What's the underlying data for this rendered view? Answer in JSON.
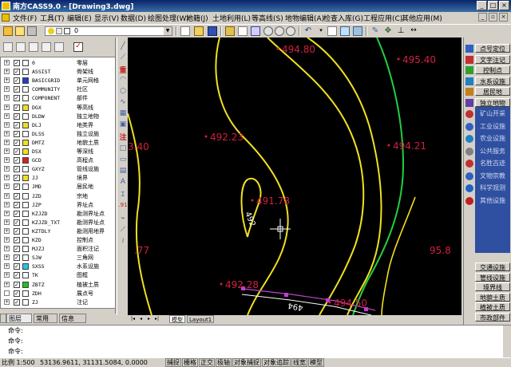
{
  "window": {
    "title": "南方CASS9.0 - [Drawing3.dwg]",
    "minimize": "_",
    "maximize": "□",
    "close": "×"
  },
  "menu": {
    "items": [
      "文件(F)",
      "工具(T)",
      "编辑(E)",
      "显示(V)",
      "数据(D)",
      "绘图处理(W)",
      "地籍(J)",
      "土地利用(L)",
      "等高线(S)",
      "地物编辑(A)",
      "检查入库(G)",
      "工程应用(C)",
      "其他应用(M)"
    ],
    "mdi": {
      "minimize": "_",
      "restore": "▫",
      "close": "×"
    }
  },
  "toolbar": {
    "layer_value": "0"
  },
  "layers": [
    {
      "name": "0",
      "desc": "零层",
      "color": "#ffffff",
      "expand": "+"
    },
    {
      "name": "ASSIST",
      "desc": "骨架线",
      "color": "#ffffff",
      "expand": "+"
    },
    {
      "name": "BASICGRID",
      "desc": "单元网格",
      "color": "#1f3fd0",
      "expand": "+"
    },
    {
      "name": "COMMUNITY",
      "desc": "社区",
      "color": "#ffffff",
      "expand": "+"
    },
    {
      "name": "COMPONENT",
      "desc": "部件",
      "color": "#ffffff",
      "expand": "+"
    },
    {
      "name": "DGX",
      "desc": "等高线",
      "color": "#f0e020",
      "expand": "+"
    },
    {
      "name": "DLDW",
      "desc": "独立地物",
      "color": "#ffffff",
      "expand": "+"
    },
    {
      "name": "DLJ",
      "desc": "地类界",
      "color": "#f0e020",
      "expand": "+"
    },
    {
      "name": "DLSS",
      "desc": "独立设施",
      "color": "#ffffff",
      "expand": "+"
    },
    {
      "name": "DMTZ",
      "desc": "地貌土质",
      "color": "#f0e020",
      "expand": "+"
    },
    {
      "name": "DSX",
      "desc": "等深线",
      "color": "#f0e020",
      "expand": "+"
    },
    {
      "name": "GCD",
      "desc": "高程点",
      "color": "#d82020",
      "expand": "+"
    },
    {
      "name": "GXYZ",
      "desc": "管线设施",
      "color": "#ffffff",
      "expand": "+"
    },
    {
      "name": "JJ",
      "desc": "境界",
      "color": "#f0e020",
      "expand": "+"
    },
    {
      "name": "JMD",
      "desc": "居民地",
      "color": "#ffffff",
      "expand": "+"
    },
    {
      "name": "JZD",
      "desc": "宗地",
      "color": "#ffffff",
      "expand": "+"
    },
    {
      "name": "JZP",
      "desc": "界址点",
      "color": "#ffffff",
      "expand": "+"
    },
    {
      "name": "KZJZD",
      "desc": "勘测界址点",
      "color": "#ffffff",
      "expand": "+"
    },
    {
      "name": "KZJZD_TXT",
      "desc": "勘测界址点",
      "color": "#ffffff",
      "expand": "+"
    },
    {
      "name": "KZTDLY",
      "desc": "勘测用地界",
      "color": "#ffffff",
      "expand": "+"
    },
    {
      "name": "KZD",
      "desc": "控制点",
      "color": "#ffffff",
      "expand": "+"
    },
    {
      "name": "MJZJ",
      "desc": "面积注记",
      "color": "#ffffff",
      "expand": "+"
    },
    {
      "name": "SJW",
      "desc": "三角网",
      "color": "#ffffff",
      "expand": "+"
    },
    {
      "name": "SXSS",
      "desc": "水系设施",
      "color": "#20c8e0",
      "expand": "+"
    },
    {
      "name": "TK",
      "desc": "图框",
      "color": "#ffffff",
      "expand": "+"
    },
    {
      "name": "ZBTZ",
      "desc": "植被土质",
      "color": "#20c020",
      "expand": "+"
    },
    {
      "name": "ZDH",
      "desc": "展点号",
      "color": "#ffffff",
      "expand": ""
    },
    {
      "name": "ZJ",
      "desc": "注记",
      "color": "#ffffff",
      "expand": "+"
    }
  ],
  "layer_checkmark": "✓",
  "panel_tabs": [
    "图层",
    "常用",
    "信息"
  ],
  "canvas": {
    "elevations": [
      "494.80",
      "495.40",
      "492.23",
      "494.21",
      "491.78",
      "492.28",
      "494.50"
    ],
    "edge_labels": [
      "3.40",
      ".77",
      "95.8"
    ],
    "contour_labels": [
      "492",
      "494"
    ],
    "colors": {
      "background": "#000000",
      "contour": "#f0e020",
      "green_line": "#20d040",
      "points": "#d02040",
      "road": "#c040d0"
    }
  },
  "layout_tabs": [
    "模型",
    "Layout1"
  ],
  "nav_buttons": [
    "|◂",
    "◂",
    "▸",
    "▸|"
  ],
  "right_panel": {
    "top_buttons": [
      "点号定位",
      "文字注记",
      "控制点",
      "水系设施",
      "居民地",
      "独立地物"
    ],
    "blue_items": [
      "矿山开采",
      "工业设施",
      "农业设施",
      "公共服务",
      "名胜古迹",
      "文物宗教",
      "科学观测",
      "其他设施"
    ],
    "bottom_buttons": [
      "交通设施",
      "管线设施",
      "境界线",
      "地貌土质",
      "植被土质",
      "市政部件"
    ]
  },
  "command": {
    "lines": [
      "命令:",
      "命令:",
      "命令:"
    ]
  },
  "status": {
    "scale": "比例 1:500",
    "coords": "53136.9611, 31131.5084, 0.0000",
    "toggles": [
      "捕捉",
      "栅格",
      "正交",
      "极轴",
      "对象捕捉",
      "对象追踪",
      "线宽",
      "模型"
    ]
  }
}
